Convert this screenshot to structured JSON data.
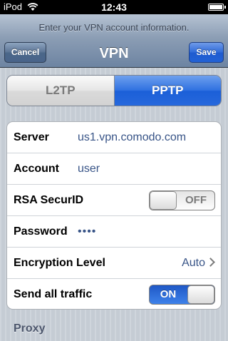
{
  "status_bar": {
    "carrier": "iPod",
    "time": "12:43",
    "wifi_icon": "wifi-icon",
    "battery_icon": "battery-icon",
    "battery_level": 1.0
  },
  "nav": {
    "prompt": "Enter your VPN account information.",
    "title": "VPN",
    "cancel_label": "Cancel",
    "save_label": "Save"
  },
  "protocol": {
    "options": [
      "L2TP",
      "PPTP"
    ],
    "selected": "PPTP"
  },
  "form": {
    "server": {
      "label": "Server",
      "value": "us1.vpn.comodo.com"
    },
    "account": {
      "label": "Account",
      "value": "user"
    },
    "rsa": {
      "label": "RSA SecurID",
      "state": "OFF"
    },
    "password": {
      "label": "Password",
      "value": "••••"
    },
    "encryption": {
      "label": "Encryption Level",
      "value": "Auto"
    },
    "send_all": {
      "label": "Send all traffic",
      "state": "ON"
    }
  },
  "proxy_header": "Proxy",
  "colors": {
    "accent_blue": "#2e70e0",
    "value_text": "#385487",
    "background": "#c5ccd4"
  }
}
